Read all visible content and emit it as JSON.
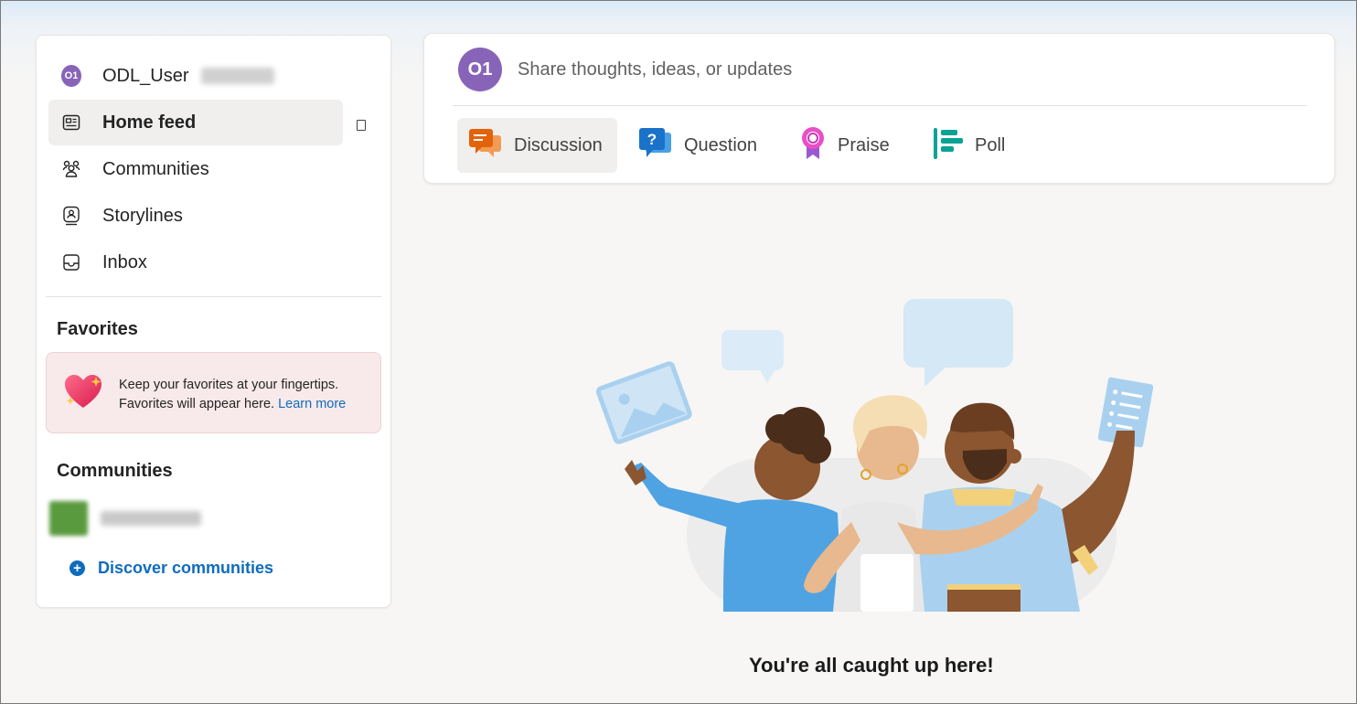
{
  "sidebar": {
    "user": {
      "initials": "O1",
      "name": "ODL_User"
    },
    "nav": [
      {
        "id": "home",
        "label": "Home feed",
        "icon": "news-icon",
        "active": true
      },
      {
        "id": "communities",
        "label": "Communities",
        "icon": "people-community-icon"
      },
      {
        "id": "storylines",
        "label": "Storylines",
        "icon": "storyline-icon"
      },
      {
        "id": "inbox",
        "label": "Inbox",
        "icon": "inbox-icon"
      }
    ],
    "favorites": {
      "title": "Favorites",
      "message": "Keep your favorites at your fingertips. Favorites will appear here.",
      "link": "Learn more",
      "icon": "heart-sparkle-icon"
    },
    "communities": {
      "title": "Communities",
      "discover_label": "Discover communities"
    }
  },
  "composer": {
    "avatar_initials": "O1",
    "placeholder": "Share thoughts, ideas, or updates",
    "post_types": [
      {
        "label": "Discussion",
        "icon": "discussion-icon",
        "color": "#e3630a",
        "active": true
      },
      {
        "label": "Question",
        "icon": "question-icon",
        "color": "#1a73c9"
      },
      {
        "label": "Praise",
        "icon": "praise-ribbon-icon",
        "color": "#c239b3"
      },
      {
        "label": "Poll",
        "icon": "poll-icon",
        "color": "#0aa295"
      }
    ]
  },
  "feed": {
    "empty_message": "You're all caught up here!"
  },
  "colors": {
    "accent": "#0f6cbd",
    "avatar": "#8764b8",
    "favorites_bg": "#f8e9ea"
  }
}
